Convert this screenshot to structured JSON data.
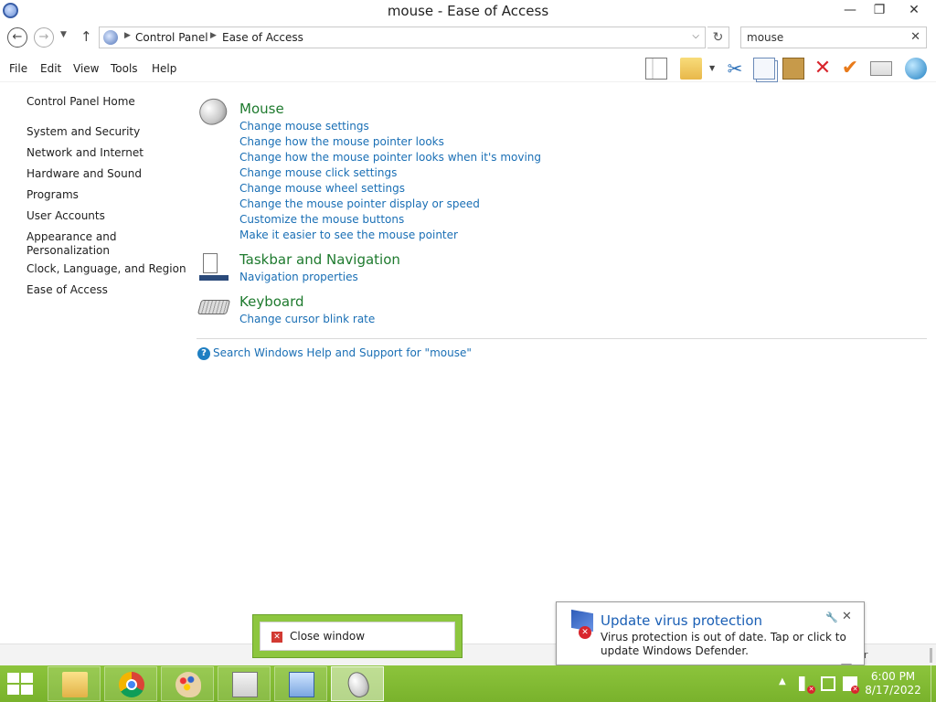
{
  "window": {
    "title": "mouse - Ease of Access",
    "minimize": "—",
    "maximize": "❐",
    "close": "✕"
  },
  "address": {
    "crumbs": [
      "Control Panel",
      "Ease of Access"
    ],
    "search_value": "mouse"
  },
  "menu": [
    "File",
    "Edit",
    "View",
    "Tools",
    "Help"
  ],
  "sidebar": {
    "items": [
      "Control Panel Home",
      "System and Security",
      "Network and Internet",
      "Hardware and Sound",
      "Programs",
      "User Accounts",
      "Appearance and Personalization",
      "Clock, Language, and Region",
      "Ease of Access"
    ]
  },
  "results": [
    {
      "title": "Mouse",
      "icon": "mouse-icon",
      "links": [
        "Change mouse settings",
        "Change how the mouse pointer looks",
        "Change how the mouse pointer looks when it's moving",
        "Change mouse click settings",
        "Change mouse wheel settings",
        "Change the mouse pointer display or speed",
        "Customize the mouse buttons",
        "Make it easier to see the mouse pointer"
      ]
    },
    {
      "title": "Taskbar and Navigation",
      "icon": "taskbar-icon",
      "links": [
        "Navigation properties"
      ]
    },
    {
      "title": "Keyboard",
      "icon": "keyboard-icon",
      "links": [
        "Change cursor blink rate"
      ]
    }
  ],
  "help_link": "Search Windows Help and Support for \"mouse\"",
  "status_char": "r",
  "close_popup": {
    "label": "Close window"
  },
  "notification": {
    "title": "Update virus protection",
    "body": "Virus protection is out of date. Tap or click to update Windows Defender."
  },
  "taskbar": {
    "apps": [
      "file-explorer-icon",
      "chrome-icon",
      "paint-icon",
      "monitor-icon",
      "control-panel-icon",
      "mouse-app-icon"
    ],
    "active_app": "mouse-app-icon"
  },
  "clock": {
    "time": "6:00 PM",
    "date": "8/17/2022"
  },
  "colors": {
    "taskbar": "#8cc43c",
    "link": "#1a6fb5",
    "category": "#1e7a2e",
    "notification_title": "#1a5fb5"
  }
}
